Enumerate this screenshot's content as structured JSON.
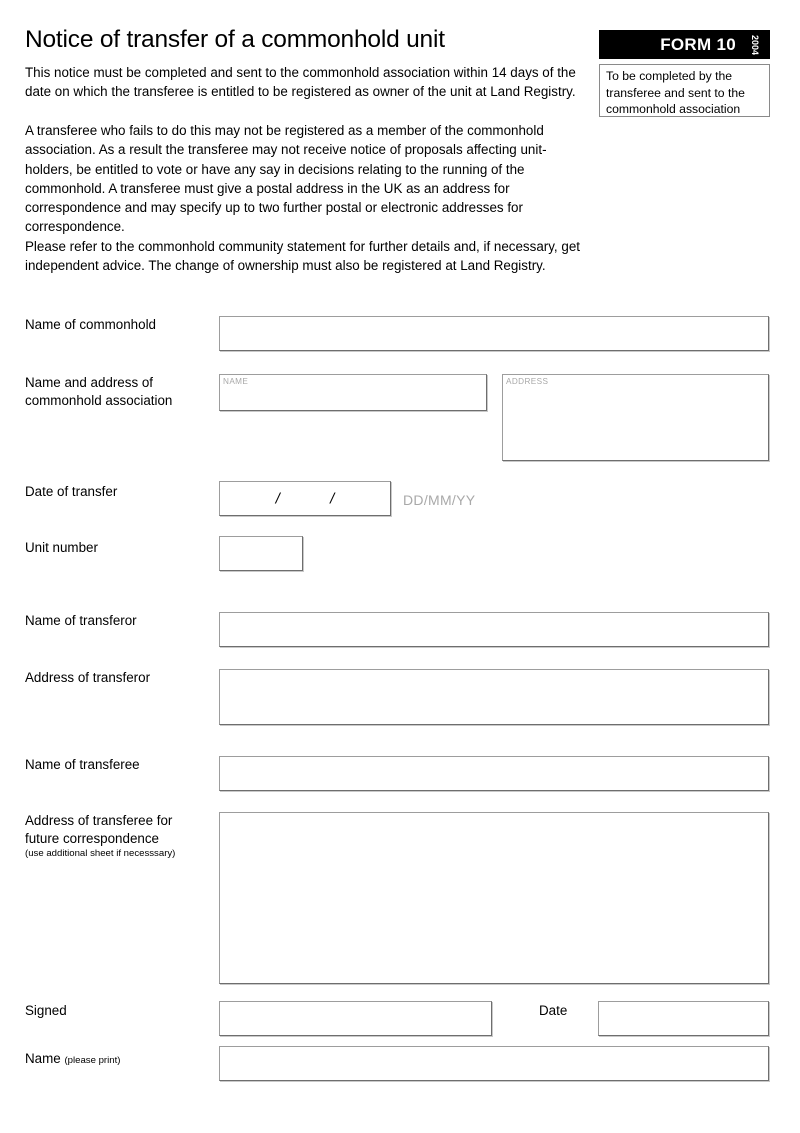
{
  "document": {
    "title": "Notice of transfer of a commonhold unit",
    "paragraphs": [
      "This notice must be completed and sent to the commonhold association within 14 days of the date on which the transferee is entitled to be registered as owner of the unit at Land Registry.",
      "A transferee who fails to do this may not be registered as a member of the commonhold association. As a result the transferee may not receive notice of proposals affecting unit-holders, be entitled to vote or have any say in decisions relating to the running of the commonhold. A transferee must give a postal address in the UK as an address for correspondence and may specify up to two further postal or electronic addresses for correspondence.",
      "Please refer to the commonhold community statement for further details and, if necessary, get independent advice. The change of ownership must also be registered at Land Registry."
    ]
  },
  "badge": {
    "form_label": "FORM 10",
    "year": "2004",
    "note": "To be completed by the transferee and sent to the commonhold association",
    "background_color": "#000000",
    "text_color": "#ffffff"
  },
  "fields": {
    "name_of_commonhold": {
      "label": "Name of commonhold",
      "value": "",
      "placeholder": ""
    },
    "association": {
      "label_line1": "Name and address of",
      "label_line2": "commonhold association",
      "name_micro_label": "NAME",
      "name_value": "",
      "address_micro_label": "ADDRESS",
      "address_value": ""
    },
    "date_of_transfer": {
      "label": "Date of transfer",
      "separator": "/",
      "value": "",
      "hint": "DD/MM/YY"
    },
    "unit_number": {
      "label": "Unit number",
      "value": ""
    },
    "name_of_transferor": {
      "label": "Name of transferor",
      "value": ""
    },
    "address_of_transferor": {
      "label": "Address of transferor",
      "value": ""
    },
    "name_of_transferee": {
      "label": "Name of transferee",
      "value": ""
    },
    "address_of_transferee": {
      "label_line1": "Address of transferee for",
      "label_line2": "future correspondence",
      "note": "(use additional sheet if necesssary)",
      "value": ""
    },
    "signed": {
      "label": "Signed",
      "value": ""
    },
    "signed_date": {
      "label": "Date",
      "value": ""
    },
    "print_name": {
      "label": "Name",
      "note": "(please print)",
      "value": ""
    }
  },
  "colors": {
    "field_border": "#9d9d9d",
    "micro_label": "#a8a8a8",
    "hint_text": "#a9a9a9",
    "page_background": "#ffffff"
  }
}
